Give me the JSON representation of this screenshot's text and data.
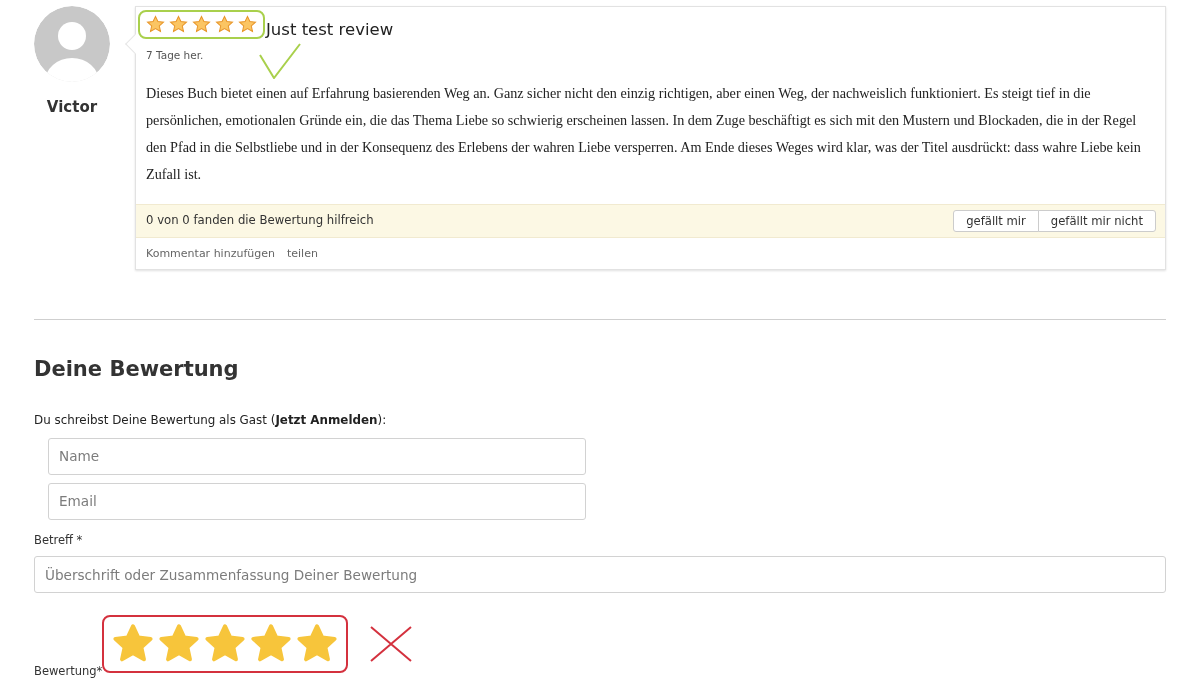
{
  "review": {
    "author": "Victor",
    "stars": 5,
    "marked_ok": true,
    "title": "Just test review",
    "date": "7 Tage her.",
    "text": "Dieses Buch bietet einen auf Erfahrung basierenden Weg an. Ganz sicher nicht den einzig richtigen, aber einen Weg, der nachweislich funktioniert. Es steigt tief in die persönlichen, emotionalen Gründe ein, die das Thema Liebe so schwierig erscheinen lassen. In dem Zuge beschäftigt es sich mit den Mustern und Blockaden, die in der Regel den Pfad in die Selbstliebe und in der Konsequenz des Erlebens der wahren Liebe versperren. Am Ende dieses Weges wird klar, was der Titel ausdrückt: dass wahre Liebe kein Zufall ist.",
    "helpful": "0 von 0 fanden die Bewertung hilfreich",
    "vote_buttons": [
      "gefällt mir",
      "gefällt mir nicht"
    ],
    "actions": [
      "Kommentar hinzufügen",
      "teilen"
    ]
  },
  "form": {
    "heading": "Deine Bewertung",
    "guest_note": "Du schreibst Deine Bewertung als Gast (**Jetzt Anmelden**):",
    "fields": [
      {
        "placeholder": "Name"
      },
      {
        "placeholder": "Email"
      }
    ],
    "subject": {
      "label": "Betreff *",
      "placeholder": "Überschrift oder Zusammenfassung Deiner Bewertung"
    },
    "rating": {
      "label": "Bewertung*",
      "stars": 5,
      "marked_ok": false
    }
  }
}
